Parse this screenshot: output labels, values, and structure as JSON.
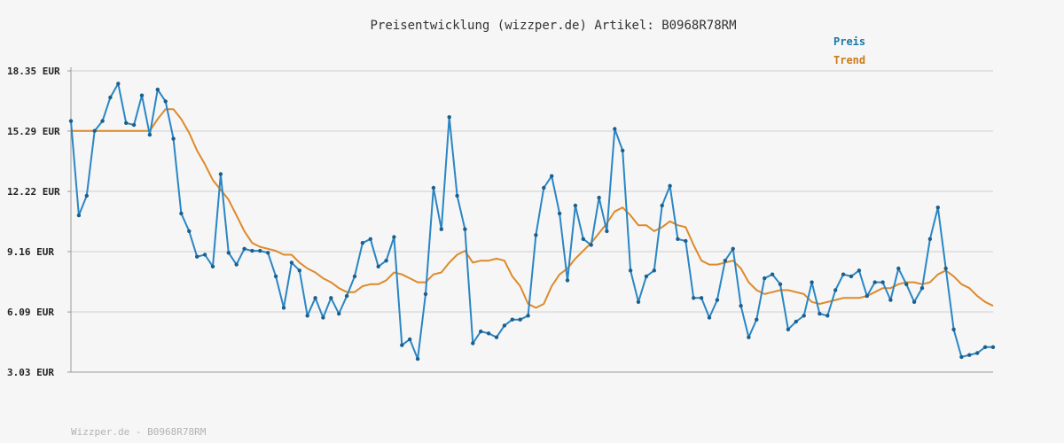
{
  "colors": {
    "background": "#f6f6f6",
    "grid": "#e2e2e2",
    "axis": "#999999",
    "price": "#2a86c4",
    "trend": "#dd8a2a",
    "legend_price": "#1a78a8",
    "legend_trend": "#cc7a14"
  },
  "footer": "Wizzper.de - B0968R78RM",
  "chart_data": {
    "type": "line",
    "title": "Preisentwicklung (wizzper.de) Artikel: B0968R78RM",
    "xlabel": "",
    "ylabel": "",
    "ylim": [
      3.03,
      18.35
    ],
    "yticks": [
      3.03,
      6.09,
      9.16,
      12.22,
      15.29,
      18.35
    ],
    "ytick_labels": [
      "3.03 EUR",
      "6.09 EUR",
      "9.16 EUR",
      "12.22 EUR",
      "15.29 EUR",
      "18.35 EUR"
    ],
    "grid": true,
    "legend_position": "top-right",
    "series": [
      {
        "name": "Preis",
        "color": "#2a86c4",
        "markers": true,
        "values": [
          15.8,
          11.0,
          12.0,
          15.3,
          15.8,
          17.0,
          17.7,
          15.7,
          15.6,
          17.1,
          15.1,
          17.4,
          16.8,
          14.9,
          11.1,
          10.2,
          8.9,
          9.0,
          8.4,
          13.1,
          9.1,
          8.5,
          9.3,
          9.2,
          9.2,
          9.1,
          7.9,
          6.3,
          8.6,
          8.2,
          5.9,
          6.8,
          5.8,
          6.8,
          6.0,
          6.9,
          7.9,
          9.6,
          9.8,
          8.4,
          8.7,
          9.9,
          4.4,
          4.7,
          3.7,
          7.0,
          12.4,
          10.3,
          16.0,
          12.0,
          10.3,
          4.5,
          5.1,
          5.0,
          4.8,
          5.4,
          5.7,
          5.7,
          5.9,
          10.0,
          12.4,
          13.0,
          11.1,
          7.7,
          11.5,
          9.8,
          9.5,
          11.9,
          10.2,
          15.4,
          14.3,
          8.2,
          6.6,
          7.9,
          8.2,
          11.5,
          12.5,
          9.8,
          9.7,
          6.8,
          6.8,
          5.8,
          6.7,
          8.7,
          9.3,
          6.4,
          4.8,
          5.7,
          7.8,
          8.0,
          7.5,
          5.2,
          5.6,
          5.9,
          7.6,
          6.0,
          5.9,
          7.2,
          8.0,
          7.9,
          8.2,
          6.9,
          7.6,
          7.6,
          6.7,
          8.3,
          7.5,
          6.6,
          7.3,
          9.8,
          11.4,
          8.3,
          5.2,
          3.8,
          3.9,
          4.0,
          4.3,
          4.3
        ]
      },
      {
        "name": "Trend",
        "color": "#dd8a2a",
        "markers": false,
        "values": [
          15.3,
          15.3,
          15.3,
          15.3,
          15.3,
          15.3,
          15.3,
          15.3,
          15.3,
          15.3,
          15.3,
          15.9,
          16.4,
          16.4,
          15.9,
          15.2,
          14.3,
          13.6,
          12.8,
          12.3,
          11.8,
          11.0,
          10.2,
          9.6,
          9.4,
          9.3,
          9.2,
          9.0,
          9.0,
          8.6,
          8.3,
          8.1,
          7.8,
          7.6,
          7.3,
          7.1,
          7.1,
          7.4,
          7.5,
          7.5,
          7.7,
          8.1,
          8.0,
          7.8,
          7.6,
          7.6,
          8.0,
          8.1,
          8.6,
          9.0,
          9.2,
          8.6,
          8.7,
          8.7,
          8.8,
          8.7,
          7.9,
          7.4,
          6.5,
          6.3,
          6.5,
          7.4,
          8.0,
          8.3,
          8.8,
          9.2,
          9.6,
          10.1,
          10.6,
          11.2,
          11.4,
          11.0,
          10.5,
          10.5,
          10.2,
          10.4,
          10.7,
          10.5,
          10.4,
          9.5,
          8.7,
          8.5,
          8.5,
          8.6,
          8.7,
          8.3,
          7.6,
          7.2,
          7.0,
          7.1,
          7.2,
          7.2,
          7.1,
          7.0,
          6.6,
          6.5,
          6.6,
          6.7,
          6.8,
          6.8,
          6.8,
          6.9,
          7.1,
          7.3,
          7.3,
          7.5,
          7.6,
          7.6,
          7.5,
          7.6,
          8.0,
          8.2,
          7.9,
          7.5,
          7.3,
          6.9,
          6.6,
          6.4
        ]
      }
    ]
  }
}
